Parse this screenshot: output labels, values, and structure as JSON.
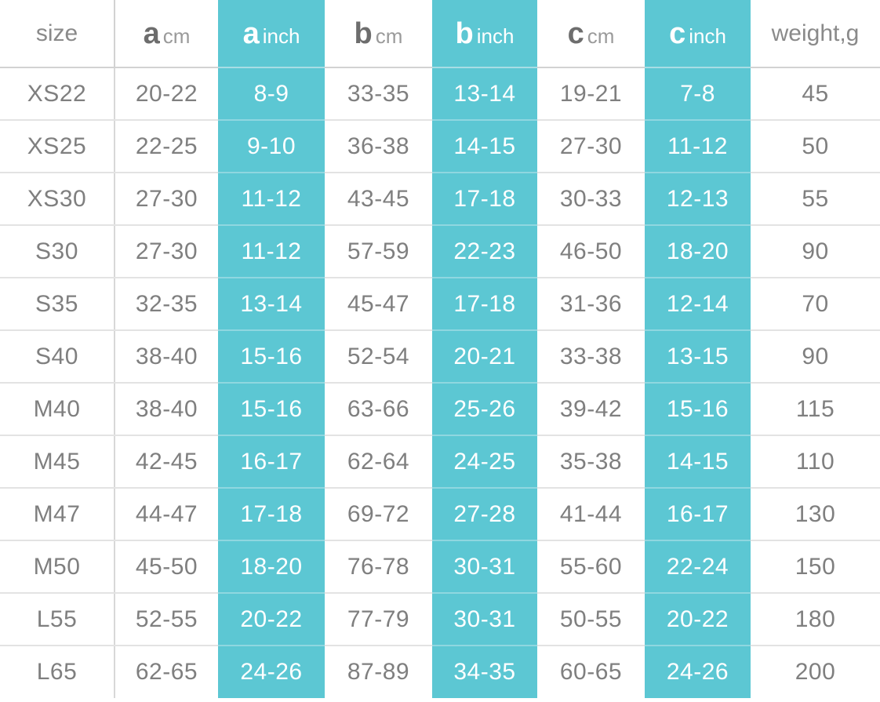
{
  "table": {
    "accent_color": "#5cc7d3",
    "text_color": "#7f7f7f",
    "header_color": "#8a8a8a",
    "columns": [
      {
        "id": "size",
        "letter": "",
        "unit": "",
        "plain": "size",
        "highlight": false
      },
      {
        "id": "a_cm",
        "letter": "a",
        "unit": "cm",
        "plain": "",
        "highlight": false
      },
      {
        "id": "a_inch",
        "letter": "a",
        "unit": "inch",
        "plain": "",
        "highlight": true
      },
      {
        "id": "b_cm",
        "letter": "b",
        "unit": "cm",
        "plain": "",
        "highlight": false
      },
      {
        "id": "b_inch",
        "letter": "b",
        "unit": "inch",
        "plain": "",
        "highlight": true
      },
      {
        "id": "c_cm",
        "letter": "c",
        "unit": "cm",
        "plain": "",
        "highlight": false
      },
      {
        "id": "c_inch",
        "letter": "c",
        "unit": "inch",
        "plain": "",
        "highlight": true
      },
      {
        "id": "weight",
        "letter": "",
        "unit": "",
        "plain": "weight,g",
        "highlight": false
      }
    ],
    "rows": [
      {
        "size": "XS22",
        "a_cm": "20-22",
        "a_inch": "8-9",
        "b_cm": "33-35",
        "b_inch": "13-14",
        "c_cm": "19-21",
        "c_inch": "7-8",
        "weight": "45"
      },
      {
        "size": "XS25",
        "a_cm": "22-25",
        "a_inch": "9-10",
        "b_cm": "36-38",
        "b_inch": "14-15",
        "c_cm": "27-30",
        "c_inch": "11-12",
        "weight": "50"
      },
      {
        "size": "XS30",
        "a_cm": "27-30",
        "a_inch": "11-12",
        "b_cm": "43-45",
        "b_inch": "17-18",
        "c_cm": "30-33",
        "c_inch": "12-13",
        "weight": "55"
      },
      {
        "size": "S30",
        "a_cm": "27-30",
        "a_inch": "11-12",
        "b_cm": "57-59",
        "b_inch": "22-23",
        "c_cm": "46-50",
        "c_inch": "18-20",
        "weight": "90"
      },
      {
        "size": "S35",
        "a_cm": "32-35",
        "a_inch": "13-14",
        "b_cm": "45-47",
        "b_inch": "17-18",
        "c_cm": "31-36",
        "c_inch": "12-14",
        "weight": "70"
      },
      {
        "size": "S40",
        "a_cm": "38-40",
        "a_inch": "15-16",
        "b_cm": "52-54",
        "b_inch": "20-21",
        "c_cm": "33-38",
        "c_inch": "13-15",
        "weight": "90"
      },
      {
        "size": "M40",
        "a_cm": "38-40",
        "a_inch": "15-16",
        "b_cm": "63-66",
        "b_inch": "25-26",
        "c_cm": "39-42",
        "c_inch": "15-16",
        "weight": "115"
      },
      {
        "size": "M45",
        "a_cm": "42-45",
        "a_inch": "16-17",
        "b_cm": "62-64",
        "b_inch": "24-25",
        "c_cm": "35-38",
        "c_inch": "14-15",
        "weight": "110"
      },
      {
        "size": "M47",
        "a_cm": "44-47",
        "a_inch": "17-18",
        "b_cm": "69-72",
        "b_inch": "27-28",
        "c_cm": "41-44",
        "c_inch": "16-17",
        "weight": "130"
      },
      {
        "size": "M50",
        "a_cm": "45-50",
        "a_inch": "18-20",
        "b_cm": "76-78",
        "b_inch": "30-31",
        "c_cm": "55-60",
        "c_inch": "22-24",
        "weight": "150"
      },
      {
        "size": "L55",
        "a_cm": "52-55",
        "a_inch": "20-22",
        "b_cm": "77-79",
        "b_inch": "30-31",
        "c_cm": "50-55",
        "c_inch": "20-22",
        "weight": "180"
      },
      {
        "size": "L65",
        "a_cm": "62-65",
        "a_inch": "24-26",
        "b_cm": "87-89",
        "b_inch": "34-35",
        "c_cm": "60-65",
        "c_inch": "24-26",
        "weight": "200"
      }
    ]
  }
}
